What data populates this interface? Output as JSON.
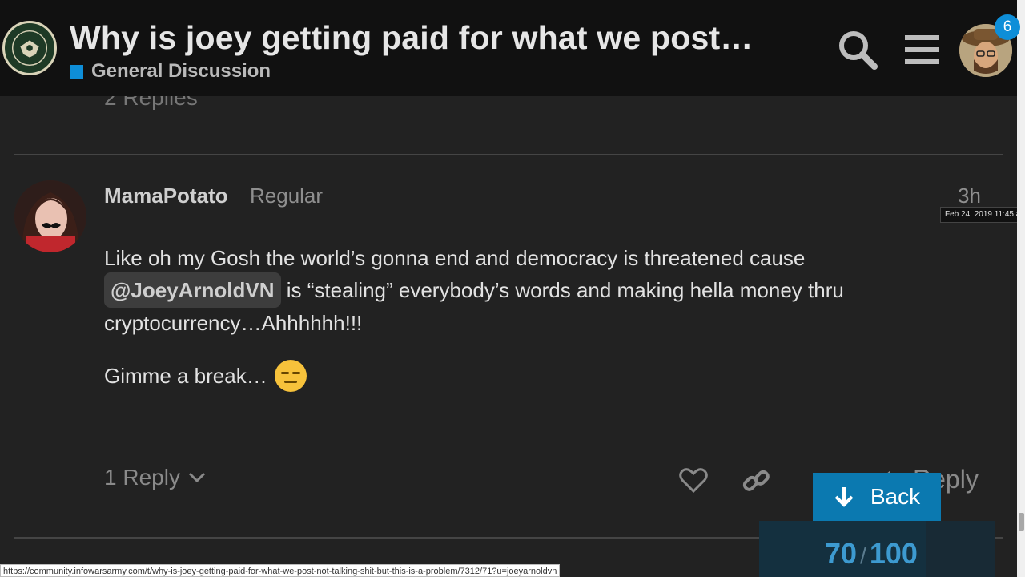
{
  "header": {
    "title": "Why is joey getting paid for what we post…",
    "category": "General Discussion",
    "category_color": "#0e8ed8",
    "notification_count": "6",
    "logo_text": "INFOWARS ARMY"
  },
  "previous_post": {
    "replies_label": "2 Replies",
    "reply_label": "Reply"
  },
  "post": {
    "username": "MamaPotato",
    "user_title": "Regular",
    "relative_time": "3h",
    "date_tooltip": "Feb 24, 2019 11:45 am",
    "body_text_1": "Like oh my Gosh the world’s gonna end and democracy is threatened cause ",
    "mention": "@JoeyArnoldVN",
    "body_text_2": " is “stealing” everybody’s words and making hella money thru cryptocurrency…Ahhhhhh!!!",
    "body_paragraph_2": "Gimme a break…",
    "replies_label": "1 Reply",
    "reply_label": "Reply"
  },
  "timeline": {
    "back_label": "Back",
    "current": "70",
    "separator": "/",
    "total": "100"
  },
  "status_bar": {
    "url": "https://community.infowarsarmy.com/t/why-is-joey-getting-paid-for-what-we-post-not-talking-shit-but-this-is-a-problem/7312/71?u=joeyarnoldvn"
  },
  "icons": {
    "search": "search-icon",
    "menu": "hamburger-menu-icon",
    "like": "heart-icon",
    "link": "link-icon",
    "more": "more-icon",
    "reply": "reply-arrow-icon",
    "back": "arrow-down-icon",
    "chevron": "chevron-down-icon",
    "emoji": "expressionless-face-emoji"
  }
}
